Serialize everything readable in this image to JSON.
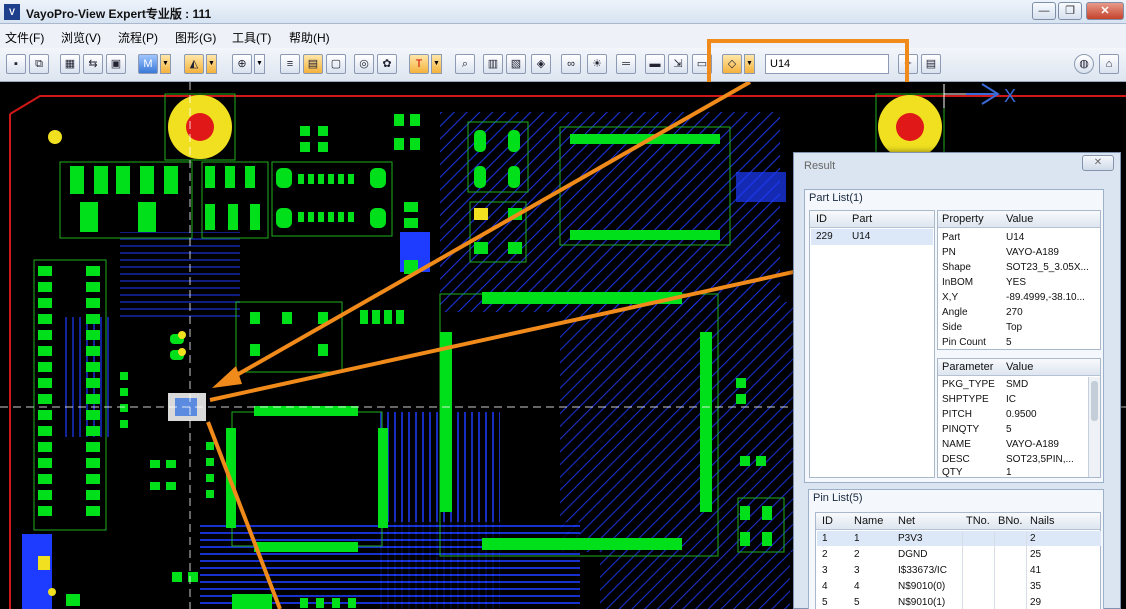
{
  "window": {
    "icon_text": "V",
    "title": "VayoPro-View Expert专业版 : 111",
    "buttons": [
      "—",
      "❐",
      "✕"
    ]
  },
  "menu": [
    {
      "label": "文件(F)"
    },
    {
      "label": "浏览(V)"
    },
    {
      "label": "流程(P)"
    },
    {
      "label": "图形(G)"
    },
    {
      "label": "工具(T)"
    },
    {
      "label": "帮助(H)"
    }
  ],
  "toolbar": {
    "search_value": "U14"
  },
  "canvas": {
    "axis_label": "X",
    "colors": {
      "background": "#000000",
      "pads": "#00e01a",
      "traces": "#1e3cff",
      "outline": "#20b020",
      "board_edge": "#d01818",
      "fiducial_outer": "#f0e020",
      "fiducial_inner": "#e01818",
      "annotation": "#f08a1a"
    }
  },
  "result": {
    "title": "Result",
    "close_label": "✕",
    "part_list": {
      "label": "Part List(1)",
      "headers": [
        "ID",
        "Part"
      ],
      "rows": [
        [
          "229",
          "U14"
        ]
      ]
    },
    "properties": {
      "headers": [
        "Property",
        "Value"
      ],
      "rows": [
        [
          "Part",
          "U14"
        ],
        [
          "PN",
          "VAYO-A189"
        ],
        [
          "Shape",
          "SOT23_5_3.05X..."
        ],
        [
          "InBOM",
          "YES"
        ],
        [
          "X,Y",
          "-89.4999,-38.10..."
        ],
        [
          "Angle",
          "270"
        ],
        [
          "Side",
          "Top"
        ],
        [
          "Pin Count",
          "5"
        ]
      ]
    },
    "parameters": {
      "headers": [
        "Parameter",
        "Value"
      ],
      "rows": [
        [
          "PKG_TYPE",
          "SMD"
        ],
        [
          "SHPTYPE",
          "IC"
        ],
        [
          "PITCH",
          "0.9500"
        ],
        [
          "PINQTY",
          "5"
        ],
        [
          "NAME",
          "VAYO-A189"
        ],
        [
          "DESC",
          "SOT23,5PIN,..."
        ],
        [
          "QTY",
          "1"
        ]
      ]
    },
    "pin_list": {
      "label": "Pin List(5)",
      "headers": [
        "ID",
        "Name",
        "Net",
        "TNo.",
        "BNo.",
        "Nails"
      ],
      "rows": [
        [
          "1",
          "1",
          "P3V3",
          "",
          "",
          "2"
        ],
        [
          "2",
          "2",
          "DGND",
          "",
          "",
          "25"
        ],
        [
          "3",
          "3",
          "I$33673/IC",
          "",
          "",
          "41"
        ],
        [
          "4",
          "4",
          "N$9010(0)",
          "",
          "",
          "35"
        ],
        [
          "5",
          "5",
          "N$9010(1)",
          "",
          "",
          "29"
        ]
      ]
    }
  }
}
